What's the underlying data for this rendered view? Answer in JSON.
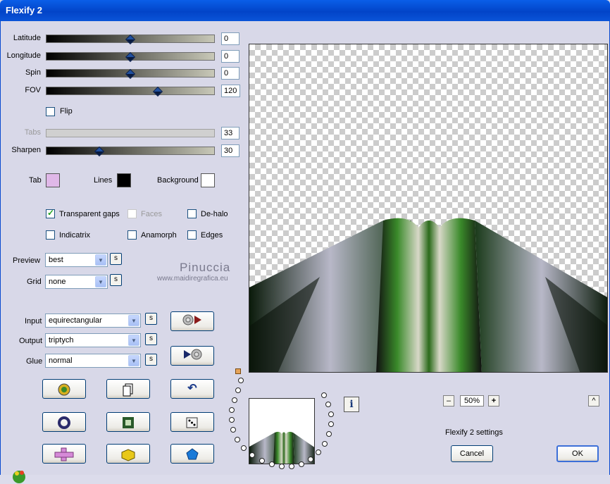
{
  "window": {
    "title": "Flexify 2"
  },
  "sliders": [
    {
      "label": "Latitude",
      "value": "0",
      "position": 0.5
    },
    {
      "label": "Longitude",
      "value": "0",
      "position": 0.5
    },
    {
      "label": "Spin",
      "value": "0",
      "position": 0.5
    },
    {
      "label": "FOV",
      "value": "120",
      "position": 0.66
    },
    {
      "label": "Tabs",
      "value": "33",
      "position": null
    },
    {
      "label": "Sharpen",
      "value": "30",
      "position": 0.3
    }
  ],
  "flip": {
    "label": "Flip",
    "checked": false
  },
  "colors": {
    "tab_label": "Tab",
    "tab_color": "#e0b8e8",
    "lines_label": "Lines",
    "lines_color": "#000000",
    "background_label": "Background",
    "background_color": "#ffffff"
  },
  "options": {
    "transparent_gaps": "Transparent gaps",
    "faces": "Faces",
    "de_halo": "De-halo",
    "indicatrix": "Indicatrix",
    "anamorph": "Anamorph",
    "edges": "Edges"
  },
  "dropdowns": {
    "preview_label": "Preview",
    "preview_value": "best",
    "grid_label": "Grid",
    "grid_value": "none",
    "input_label": "Input",
    "input_value": "equirectangular",
    "output_label": "Output",
    "output_value": "triptych",
    "glue_label": "Glue",
    "glue_value": "normal",
    "s": "s"
  },
  "watermark": {
    "line1": "Pinuccia",
    "line2": "www.maidiregrafica.eu"
  },
  "zoom": {
    "minus": "–",
    "value": "50%",
    "plus": "+",
    "up": "^"
  },
  "settings_label": "Flexify 2 settings",
  "info": "i",
  "buttons": {
    "cancel": "Cancel",
    "ok": "OK"
  },
  "icons": {
    "play_forward": "play-right-icon",
    "play_back": "play-left-icon",
    "randomize": "dice-icon",
    "undo": "undo-icon",
    "copy": "copy-icon",
    "circle": "circle-icon",
    "square": "square-icon",
    "cross": "cross-icon",
    "block": "block-icon",
    "pentagon": "pentagon-icon",
    "frog": "frog-icon"
  },
  "accent_colors": {
    "titlebar": "#0a5fe8",
    "dialog": "#d8d8e8",
    "check_green": "#21a121"
  }
}
